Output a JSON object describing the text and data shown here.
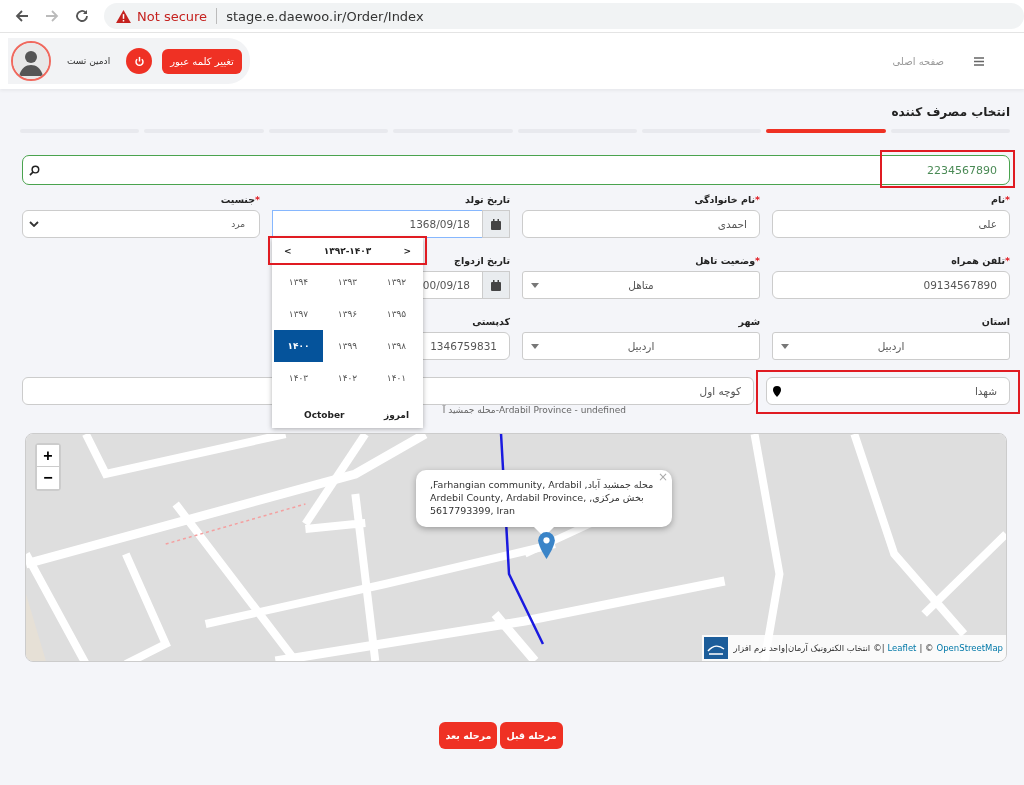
{
  "browser": {
    "security": "Not secure",
    "url": "stage.e.daewoo.ir/Order/Index"
  },
  "header": {
    "change_password": "تغییر کلمه عبور",
    "user_name": "ادمین تست",
    "home": "صفحه اصلی"
  },
  "page_title": "انتخاب مصرف کننده",
  "steps": [
    {
      "selected": false
    },
    {
      "selected": true
    },
    {
      "selected": false
    },
    {
      "selected": false
    },
    {
      "selected": false
    },
    {
      "selected": false
    },
    {
      "selected": false
    },
    {
      "selected": false
    }
  ],
  "search": {
    "value": "2234567890",
    "highlighted": true
  },
  "form": {
    "rows": [
      [
        {
          "kind": "text",
          "label": "نام",
          "required_mark": "*",
          "value": "علی"
        },
        {
          "kind": "text",
          "label": "نام خانوادگی",
          "required_mark": "*",
          "value": "احمدی"
        },
        {
          "kind": "date",
          "label": "تاریخ تولد",
          "value": "1368/09/18",
          "focused": true,
          "picker": true
        },
        {
          "kind": "combo",
          "label": "جنسیت",
          "required_mark": "*",
          "value": "مرد"
        }
      ],
      [
        {
          "kind": "text",
          "label": "تلفن همراه",
          "required_mark": "*",
          "value": "09134567890"
        },
        {
          "kind": "select",
          "label": "وضعیت تاهل",
          "required_mark": "*",
          "value": "متاهل"
        },
        {
          "kind": "date",
          "label": "تاریخ ازدواج",
          "value": "00/09/18",
          "focused": false
        }
      ],
      [
        {
          "kind": "select",
          "label": "استان",
          "value": "اردبیل"
        },
        {
          "kind": "select",
          "label": "شهر",
          "value": "اردبیل"
        },
        {
          "kind": "text",
          "label": "کدپستی",
          "value": "1346759831"
        }
      ]
    ]
  },
  "datepicker": {
    "prev": "<",
    "range": "۱۳۹۲-۱۴۰۳",
    "next": ">",
    "highlighted": true,
    "years": [
      {
        "label": "۱۳۹۲",
        "selected": false
      },
      {
        "label": "۱۳۹۳",
        "selected": false
      },
      {
        "label": "۱۳۹۴",
        "selected": false
      },
      {
        "label": "۱۳۹۵",
        "selected": false
      },
      {
        "label": "۱۳۹۶",
        "selected": false
      },
      {
        "label": "۱۳۹۷",
        "selected": false
      },
      {
        "label": "۱۳۹۸",
        "selected": false
      },
      {
        "label": "۱۳۹۹",
        "selected": false
      },
      {
        "label": "۱۴۰۰",
        "selected": true
      },
      {
        "label": "۱۴۰۱",
        "selected": false
      },
      {
        "label": "۱۴۰۲",
        "selected": false
      },
      {
        "label": "۱۴۰۳",
        "selected": false
      }
    ],
    "today": "امروز",
    "month": "October"
  },
  "address": {
    "area": {
      "value": "شهدا",
      "highlighted": true
    },
    "street": "کوچه اول",
    "note": "محله جمشید آ-Ardabil Province - undefined"
  },
  "map": {
    "zoom_in": "+",
    "zoom_out": "−",
    "popup": {
      "text": "محله جمشید آباد, Farhangian community, Ardabil, بخش مرکزی, Ardebil County, Ardabil Province, 5617793399, Iran",
      "close": "×"
    },
    "attribution": {
      "owner": "انتخاب الکترونیک آرمان|واحد نرم افزار",
      "sep1": "©|",
      "leaflet": "Leaflet",
      "sep2": "| ©",
      "osm": "OpenStreetMap"
    }
  },
  "buttons": [
    {
      "label": "مرحله قبل"
    },
    {
      "label": "مرحله بعد"
    }
  ]
}
